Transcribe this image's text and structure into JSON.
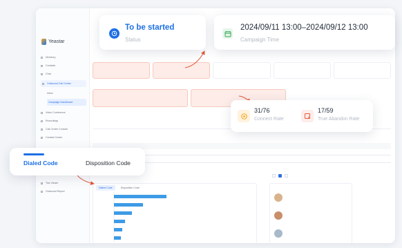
{
  "status": {
    "value": "To be started",
    "label": "Status"
  },
  "campaign": {
    "value": "2024/09/11 13:00–2024/09/12 13:00",
    "label": "Campaign Time"
  },
  "connect": {
    "value": "31/76",
    "label": "Connect Rate"
  },
  "abandon": {
    "value": "17/59",
    "label": "True Abandon Rate"
  },
  "code_tabs": [
    {
      "label": "Dialed Code",
      "active": true
    },
    {
      "label": "Disposition Code",
      "active": false
    }
  ],
  "app": {
    "logo": "Yeastar",
    "chart_tabs": [
      "Dialed Code",
      "Disposition Code"
    ],
    "sidebar": [
      "Directory",
      "Contacts",
      "Chat",
      "Outbound Call Center",
      "Inbox",
      "Campaign Dashboard",
      "Video Conference",
      "Recordings",
      "Call Center Console",
      "Contact Center",
      "Tick Viewer",
      "Outbound Report"
    ]
  },
  "colors": {
    "accent": "#1d6fe5",
    "highlight": "#fdece8",
    "arrow": "#e25a3c"
  },
  "icons": {
    "status": "clock-icon",
    "campaign": "calendar-icon",
    "connect": "target-icon",
    "abandon": "abandon-icon"
  }
}
